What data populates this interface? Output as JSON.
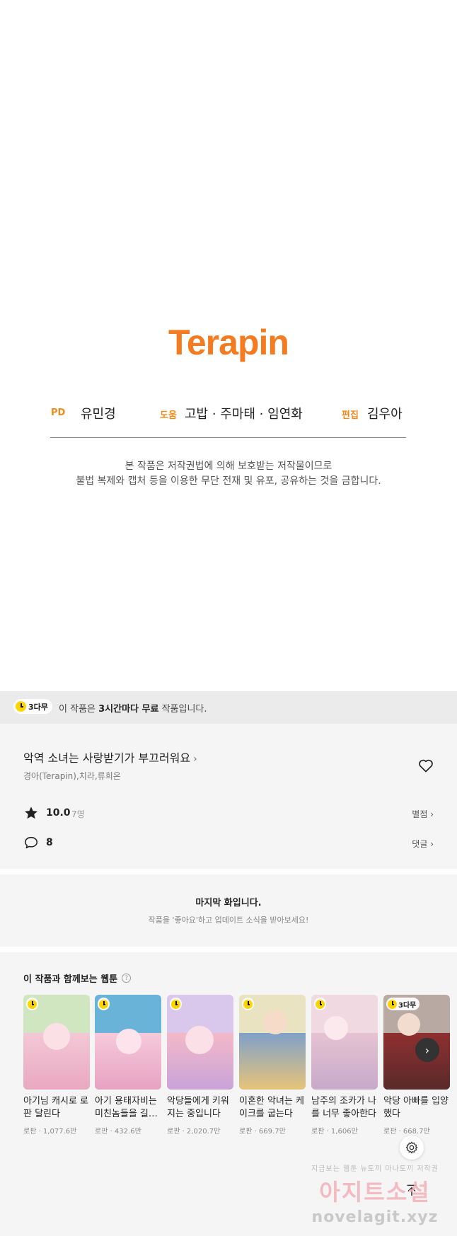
{
  "credits": {
    "logo": "Terapin",
    "staff": [
      {
        "role": "PD",
        "name": "유민경"
      },
      {
        "role": "도움",
        "name": "고밥 · 주마태 · 임연화"
      },
      {
        "role": "편집",
        "name": "김우아"
      }
    ],
    "notice_line1": "본 작품은 저작권법에 의해 보호받는 저작물이므로",
    "notice_line2": "불법 복제와 캡처 등을 이용한 무단 전재 및 유포, 공유하는 것을 금합니다."
  },
  "free_bar": {
    "badge": "3다무",
    "message_prefix": "이 작품은 ",
    "message_bold": "3시간마다 무료",
    "message_suffix": " 작품입니다."
  },
  "work": {
    "title": "악역 소녀는 사랑받기가 부끄러워요",
    "authors": "경아(Terapin),치라,류희온",
    "rating": "10.0",
    "rating_count": "7명",
    "rating_link": "별점",
    "comments": "8",
    "comments_link": "댓글"
  },
  "last_episode": {
    "title": "마지막 화입니다.",
    "subtitle": "작품을 '좋아요'하고 업데이트 소식을 받아보세요!"
  },
  "recommendations": {
    "heading": "이 작품과 함께보는 웹툰",
    "help_icon": "?",
    "items": [
      {
        "title": "아기님 캐시로 로판 달린다",
        "meta": "로판 · 1,077.6만",
        "bg": "#cfe6c0",
        "art": "#f3c8d6"
      },
      {
        "title": "아기 용태자비는 미친놈들을 길…",
        "meta": "로판 · 432.6만",
        "bg": "#6ab3d8",
        "art": "#f6c9da"
      },
      {
        "title": "악당들에게 키워지는 중입니다",
        "meta": "로판 · 2,020.7만",
        "bg": "#d9c7ec",
        "art": "#f4b9c8"
      },
      {
        "title": "이혼한 악녀는 케이크를 굽는다",
        "meta": "로판 · 669.7만",
        "bg": "#e9e3c2",
        "art": "#7fa1c9"
      },
      {
        "title": "남주의 조카가 나를 너무 좋아한다",
        "meta": "로판 · 1,606만",
        "bg": "#f1d9e2",
        "art": "#e6c3d3"
      },
      {
        "title": "악당 아빠를 입양했다",
        "meta": "로판 · 668.7만",
        "bg": "#b9a9a3",
        "art": "#8e2f2f",
        "badge": "3다무"
      }
    ]
  },
  "watermark": {
    "line1": "지금보는 웹툰 뉴토끼 마나토끼 저작권",
    "line2": "아지트소설",
    "line3": "novelagit.xyz"
  }
}
